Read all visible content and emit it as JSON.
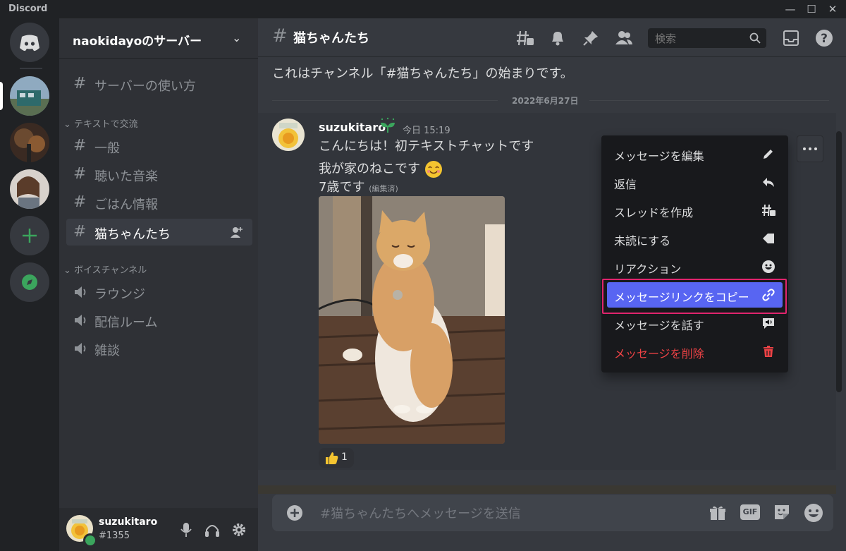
{
  "app": {
    "title": "Discord"
  },
  "server": {
    "name": "naokidayoのサーバー"
  },
  "sidebar": {
    "top_channel": "サーバーの使い方",
    "text_category": "テキストで交流",
    "text_channels": [
      "一般",
      "聴いた音楽",
      "ごはん情報",
      "猫ちゃんたち"
    ],
    "voice_category": "ボイスチャンネル",
    "voice_channels": [
      "ラウンジ",
      "配信ルーム",
      "雑談"
    ]
  },
  "user": {
    "name": "suzukitaro",
    "tag": "#1355",
    "status_color": "#3ba55d"
  },
  "channel": {
    "name": "猫ちゃんたち",
    "search_placeholder": "検索",
    "welcome": "これはチャンネル「#猫ちゃんたち」の始まりです。",
    "date_divider": "2022年6月27日"
  },
  "message": {
    "author": "suzukitaro",
    "timestamp": "今日 15:19",
    "line1": "こんにちは！初テキストチャットです",
    "line2": "我が家のねこです",
    "line3": "7歳です",
    "edited": "(編集済)",
    "reaction_count": "1"
  },
  "composer": {
    "placeholder": "#猫ちゃんたちへメッセージを送信",
    "gif_label": "GIF"
  },
  "context_menu": {
    "items": [
      {
        "label": "メッセージを編集",
        "icon": "pencil-icon"
      },
      {
        "label": "返信",
        "icon": "reply-icon"
      },
      {
        "label": "スレッドを作成",
        "icon": "thread-icon"
      },
      {
        "label": "未読にする",
        "icon": "mark-unread-icon"
      },
      {
        "label": "リアクション",
        "icon": "emoji-icon"
      },
      {
        "label": "メッセージリンクをコピー",
        "icon": "link-icon"
      },
      {
        "label": "メッセージを話す",
        "icon": "speak-icon"
      },
      {
        "label": "メッセージを削除",
        "icon": "trash-icon"
      }
    ]
  },
  "colors": {
    "accent": "#5865f2",
    "danger": "#ed4245",
    "highlight_frame": "#e0246d",
    "green": "#3ba55d"
  }
}
